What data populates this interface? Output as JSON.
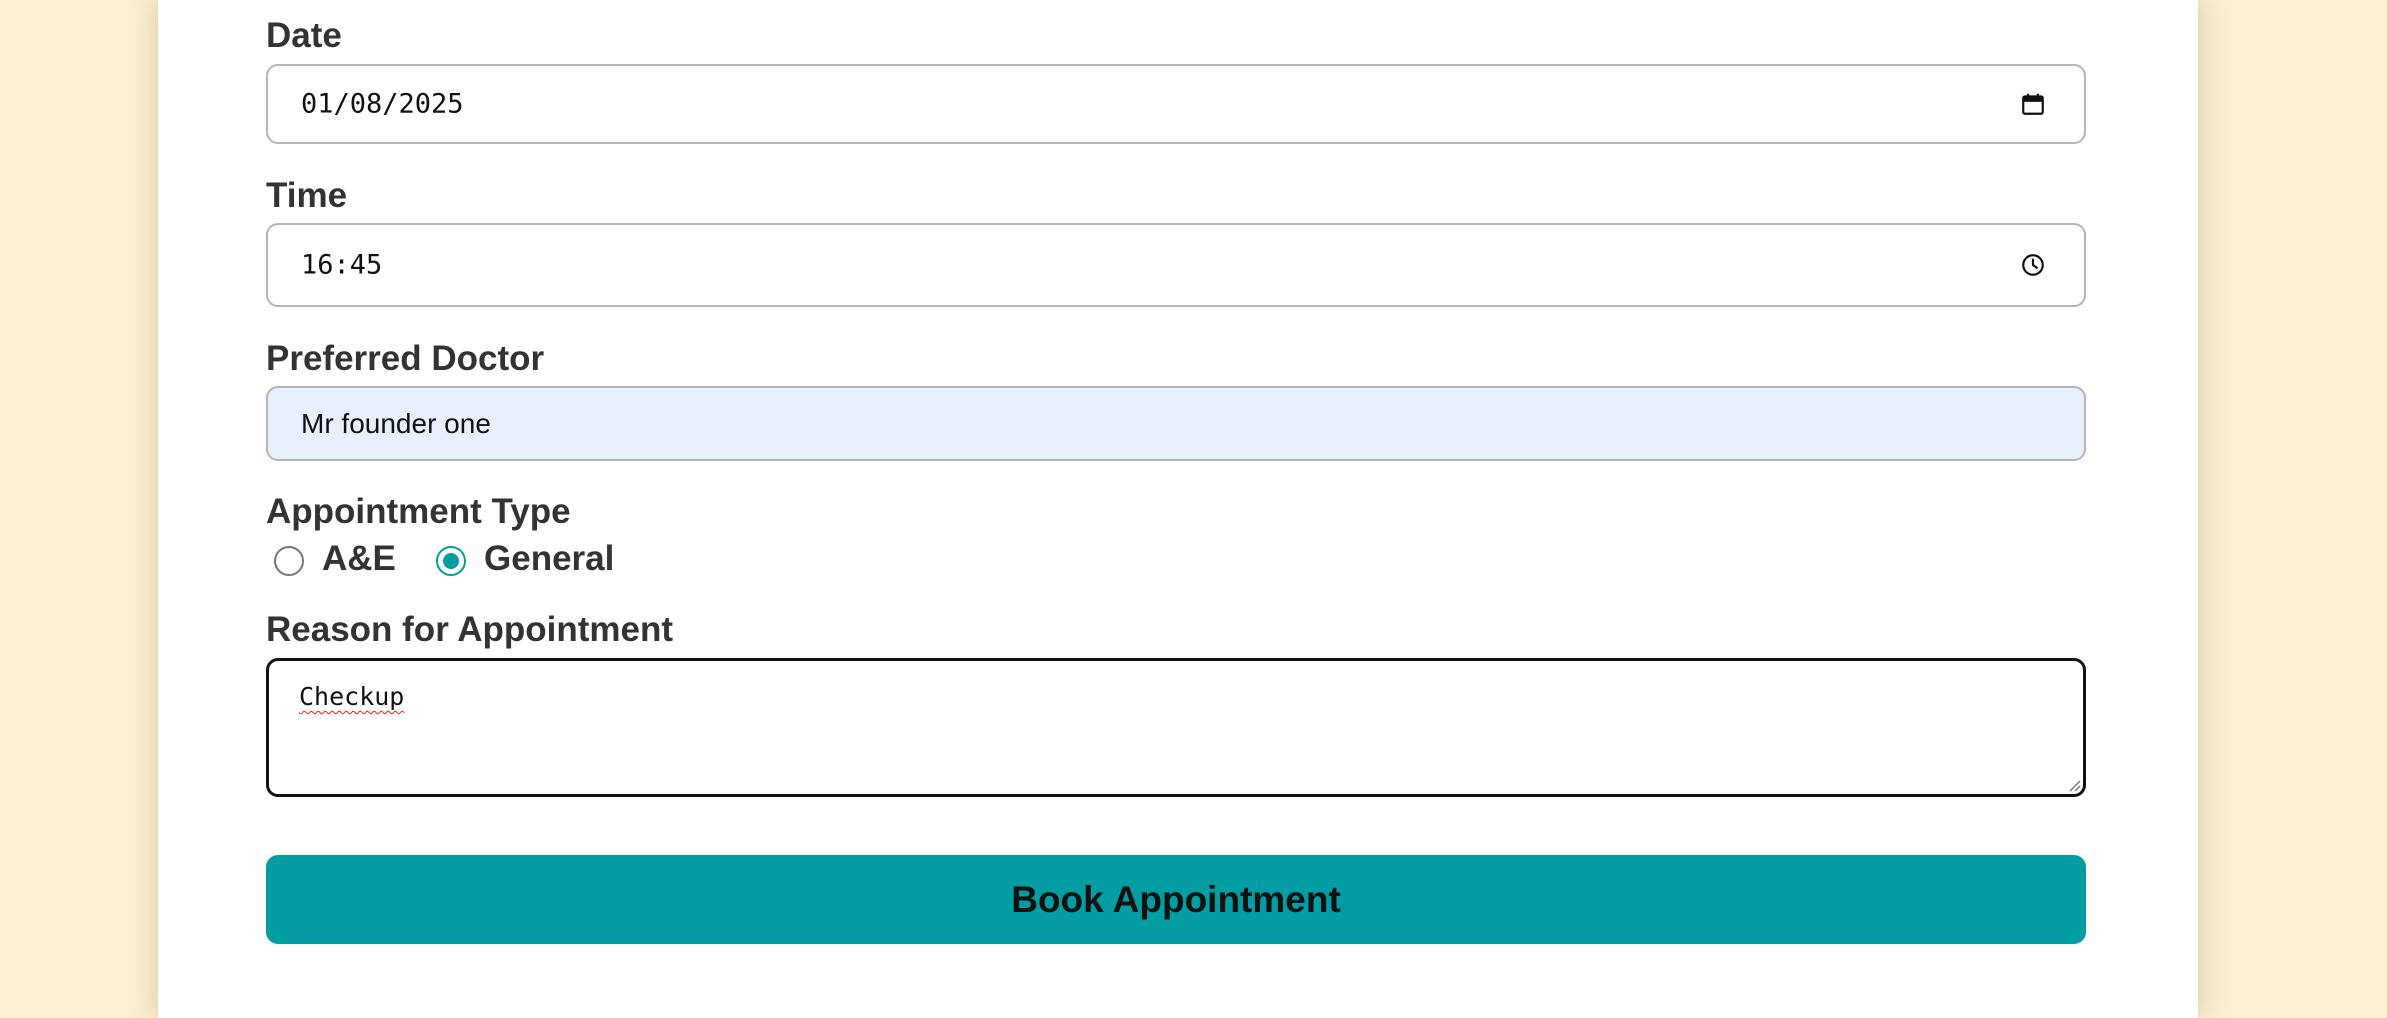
{
  "form": {
    "date": {
      "label": "Date",
      "value": "01/08/2025",
      "icon": "calendar-icon"
    },
    "time": {
      "label": "Time",
      "value": "16:45",
      "icon": "clock-icon"
    },
    "doctor": {
      "label": "Preferred Doctor",
      "value": "Mr founder one"
    },
    "appointment_type": {
      "label": "Appointment Type",
      "options": [
        {
          "label": "A&E",
          "checked": false
        },
        {
          "label": "General",
          "checked": true
        }
      ]
    },
    "reason": {
      "label": "Reason for Appointment",
      "value": "Checkup"
    },
    "submit_label": "Book Appointment"
  },
  "colors": {
    "page_background": "#fdefd2",
    "card_background": "#ffffff",
    "accent": "#019da3",
    "autofill_background": "#e8f0fe",
    "label_text": "#333333"
  }
}
